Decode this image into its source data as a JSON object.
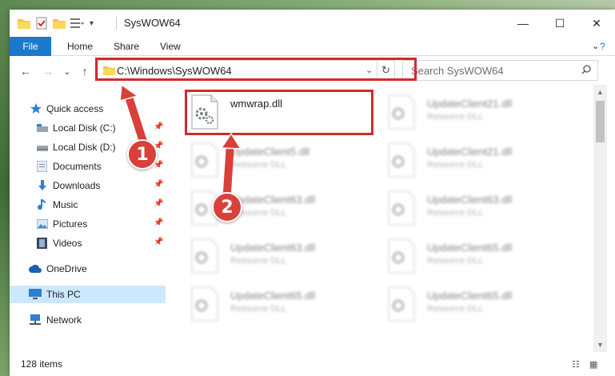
{
  "window": {
    "title": "SysWOW64",
    "controls": {
      "minimize": "—",
      "maximize": "☐",
      "close": "✕"
    }
  },
  "ribbon": {
    "tabs": [
      "File",
      "Home",
      "Share",
      "View"
    ],
    "help": "?"
  },
  "navigation": {
    "back": "←",
    "forward": "→",
    "recent": "⌄",
    "up": "↑",
    "address": "C:\\Windows\\SysWOW64",
    "search_placeholder": "Search SysWOW64"
  },
  "sidebar": {
    "items": [
      {
        "label": "Quick access",
        "icon": "star-icon",
        "pinned": false
      },
      {
        "label": "Local Disk (C:)",
        "icon": "drive-icon",
        "pinned": true
      },
      {
        "label": "Local Disk (D:)",
        "icon": "drive-icon",
        "pinned": true
      },
      {
        "label": "Documents",
        "icon": "documents-icon",
        "pinned": true
      },
      {
        "label": "Downloads",
        "icon": "download-icon",
        "pinned": true
      },
      {
        "label": "Music",
        "icon": "music-icon",
        "pinned": true
      },
      {
        "label": "Pictures",
        "icon": "pictures-icon",
        "pinned": true
      },
      {
        "label": "Videos",
        "icon": "videos-icon",
        "pinned": true
      },
      {
        "label": "OneDrive",
        "icon": "cloud-icon",
        "pinned": false
      },
      {
        "label": "This PC",
        "icon": "computer-icon",
        "pinned": false
      },
      {
        "label": "Network",
        "icon": "network-icon",
        "pinned": false
      }
    ]
  },
  "files": [
    {
      "name": "wmwrap.dll",
      "type": "",
      "blurred": false
    },
    {
      "name": "UpdateClient21.dll",
      "type": "Resource DLL",
      "blurred": true
    },
    {
      "name": "UpdateClient5.dll",
      "type": "Resource DLL",
      "blurred": true
    },
    {
      "name": "UpdateClient21.dll",
      "type": "Resource DLL",
      "blurred": true
    },
    {
      "name": "UpdateClient63.dll",
      "type": "Resource DLL",
      "blurred": true
    },
    {
      "name": "UpdateClient63.dll",
      "type": "Resource DLL",
      "blurred": true
    },
    {
      "name": "UpdateClient63.dll",
      "type": "Resource DLL",
      "blurred": true
    },
    {
      "name": "UpdateClient65.dll",
      "type": "Resource DLL",
      "blurred": true
    },
    {
      "name": "UpdateClient65.dll",
      "type": "Resource DLL",
      "blurred": true
    },
    {
      "name": "UpdateClient65.dll",
      "type": "Resource DLL",
      "blurred": true
    }
  ],
  "status": {
    "item_count": "128 items"
  },
  "callouts": [
    "1",
    "2"
  ],
  "colors": {
    "accent": "#1979ca",
    "highlight": "#d22b2b",
    "callout": "#d9403a",
    "selected": "#cce8ff"
  }
}
